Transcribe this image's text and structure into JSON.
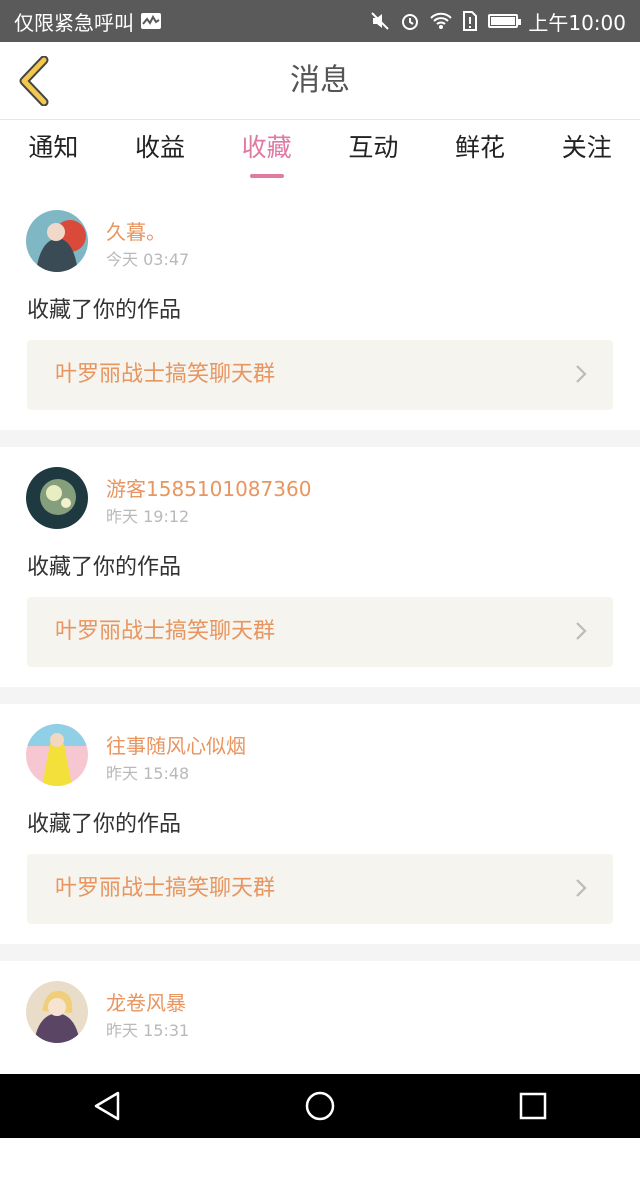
{
  "status_bar": {
    "carrier": "仅限紧急呼叫",
    "time": "上午10:00"
  },
  "header": {
    "title": "消息"
  },
  "tabs": [
    {
      "label": "通知",
      "active": false
    },
    {
      "label": "收益",
      "active": false
    },
    {
      "label": "收藏",
      "active": true
    },
    {
      "label": "互动",
      "active": false
    },
    {
      "label": "鲜花",
      "active": false
    },
    {
      "label": "关注",
      "active": false
    }
  ],
  "messages": [
    {
      "name": "久暮。",
      "time": "今天 03:47",
      "action": "收藏了你的作品",
      "work": "叶罗丽战士搞笑聊天群"
    },
    {
      "name": "游客1585101087360",
      "time": "昨天 19:12",
      "action": "收藏了你的作品",
      "work": "叶罗丽战士搞笑聊天群"
    },
    {
      "name": "往事随风心似烟",
      "time": "昨天 15:48",
      "action": "收藏了你的作品",
      "work": "叶罗丽战士搞笑聊天群"
    },
    {
      "name": "龙卷风暴",
      "time": "昨天 15:31",
      "action": "",
      "work": ""
    }
  ],
  "colors": {
    "accent_tab": "#e07aa2",
    "name_text": "#e8955f",
    "back_arrow": "#c9a22a"
  }
}
